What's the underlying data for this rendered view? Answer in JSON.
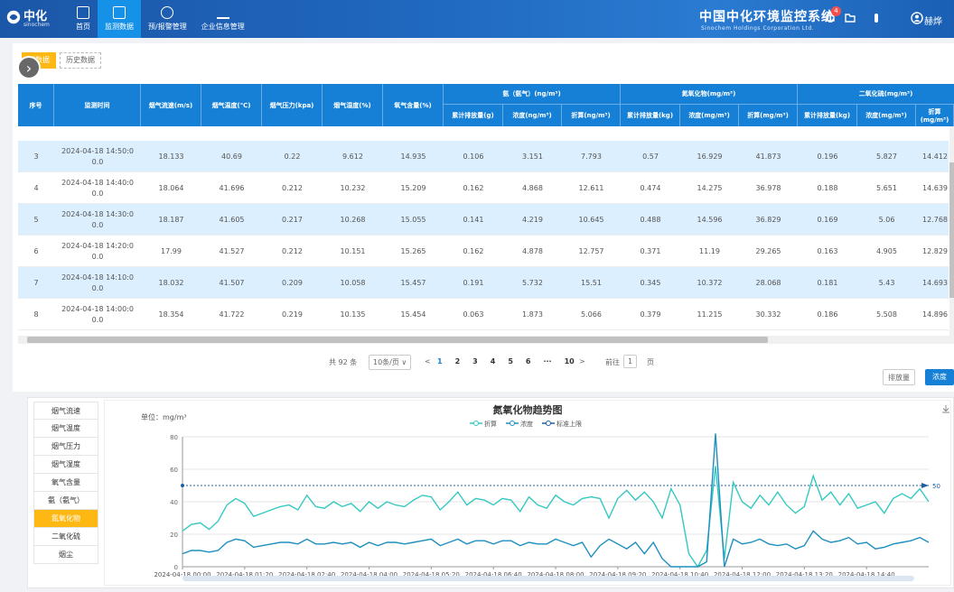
{
  "header": {
    "logo_text": "中化",
    "logo_sub": "sinochem",
    "nav": [
      {
        "label": "首页",
        "icon": "home-icon"
      },
      {
        "label": "监测数据",
        "icon": "monitor-icon"
      },
      {
        "label": "预/报警管理",
        "icon": "alarm-icon"
      },
      {
        "label": "企业信息管理",
        "icon": "enterprise-icon"
      }
    ],
    "active_nav": 1,
    "title": "中国中化环境监控系统",
    "subtitle": "Sinochem Holdings Corporation Ltd.",
    "bell_count": "4",
    "user": "赫烨"
  },
  "tabs": [
    "时数据",
    "历史数据"
  ],
  "table": {
    "headers": {
      "index": "序号",
      "time": "监测时间",
      "flow": "烟气流速(m/s)",
      "temp": "烟气温度(℃)",
      "pressure": "烟气压力(kpa)",
      "humidity": "烟气湿度(%)",
      "oxygen": "氧气含量(%)",
      "ammonia": "氨（氨气）(ng/m³)",
      "nox": "氮氧化物(mg/m³)",
      "so2": "二氧化硫(mg/m³)",
      "amm_sub": [
        "累计排放量(g)",
        "浓度(ng/m³)",
        "折算(ng/m³)"
      ],
      "nox_sub": [
        "累计排放量(kg)",
        "浓度(mg/m³)",
        "折算(mg/m³)"
      ],
      "so2_sub": [
        "累计排放量(kg)",
        "浓度(mg/m³)",
        "折算(mg/m³)"
      ]
    },
    "rows": [
      [
        "3",
        "2024-04-18 14:50:0\n0.0",
        "18.133",
        "40.69",
        "0.22",
        "9.612",
        "14.935",
        "0.106",
        "3.151",
        "7.793",
        "0.57",
        "16.929",
        "41.873",
        "0.196",
        "5.827",
        "14.412"
      ],
      [
        "4",
        "2024-04-18 14:40:0\n0.0",
        "18.064",
        "41.696",
        "0.212",
        "10.232",
        "15.209",
        "0.162",
        "4.868",
        "12.611",
        "0.474",
        "14.275",
        "36.978",
        "0.188",
        "5.651",
        "14.639"
      ],
      [
        "5",
        "2024-04-18 14:30:0\n0.0",
        "18.187",
        "41.605",
        "0.217",
        "10.268",
        "15.055",
        "0.141",
        "4.219",
        "10.645",
        "0.488",
        "14.596",
        "36.829",
        "0.169",
        "5.06",
        "12.768"
      ],
      [
        "6",
        "2024-04-18 14:20:0\n0.0",
        "17.99",
        "41.527",
        "0.212",
        "10.151",
        "15.265",
        "0.162",
        "4.878",
        "12.757",
        "0.371",
        "11.19",
        "29.265",
        "0.163",
        "4.905",
        "12.829"
      ],
      [
        "7",
        "2024-04-18 14:10:0\n0.0",
        "18.032",
        "41.507",
        "0.209",
        "10.058",
        "15.457",
        "0.191",
        "5.732",
        "15.51",
        "0.345",
        "10.372",
        "28.068",
        "0.181",
        "5.43",
        "14.693"
      ],
      [
        "8",
        "2024-04-18 14:00:0\n0.0",
        "18.354",
        "41.722",
        "0.219",
        "10.135",
        "15.454",
        "0.063",
        "1.873",
        "5.066",
        "0.379",
        "11.215",
        "30.332",
        "0.186",
        "5.508",
        "14.896"
      ]
    ]
  },
  "pager": {
    "total": "共 92 条",
    "size": "10条/页",
    "pages": [
      "1",
      "2",
      "3",
      "4",
      "5",
      "6",
      "···",
      "10"
    ],
    "current": "1",
    "goto": "前往",
    "goto_value": "1",
    "page_unit": "页",
    "prev": "<",
    "next": ">"
  },
  "buttons": {
    "emission": "排放量",
    "concentration": "浓度"
  },
  "side_items": [
    "烟气流速",
    "烟气温度",
    "烟气压力",
    "烟气湿度",
    "氧气含量",
    "氨（氨气）",
    "氮氧化物",
    "二氧化硫",
    "烟尘"
  ],
  "side_active": 6,
  "colors": {
    "primary": "#1680d6",
    "accent": "#fdb813",
    "series1": "#34c9c0",
    "series2": "#1e8fbf",
    "limit": "#1f5fa0"
  },
  "chart_data": {
    "type": "line",
    "title": "氮氧化物趋势图",
    "unit": "单位：mg/m³",
    "legend": [
      "折算",
      "浓度",
      "标准上限"
    ],
    "ylim": [
      0,
      80
    ],
    "yticks": [
      0,
      20,
      40,
      60,
      80
    ],
    "xticks": [
      "2024-04-18 00:00",
      "2024-04-18 01:20",
      "2024-04-18 02:40",
      "2024-04-18 04:00",
      "2024-04-18 05:20",
      "2024-04-18 06:40",
      "2024-04-18 08:00",
      "2024-04-18 09:20",
      "2024-04-18 10:40",
      "2024-04-18 12:00",
      "2024-04-18 13:20",
      "2024-04-18 14:40"
    ],
    "limit": 50,
    "limit_label": "50",
    "series": [
      {
        "name": "折算",
        "values": [
          22,
          26,
          27,
          23,
          28,
          38,
          42,
          39,
          31,
          33,
          35,
          37,
          38,
          35,
          44,
          37,
          36,
          40,
          37,
          39,
          34,
          40,
          36,
          40,
          38,
          37,
          41,
          44,
          43,
          35,
          40,
          46,
          38,
          42,
          41,
          38,
          42,
          41,
          34,
          43,
          38,
          36,
          44,
          40,
          38,
          42,
          43,
          42,
          30,
          42,
          47,
          41,
          46,
          40,
          30,
          48,
          38,
          8,
          0,
          10,
          62,
          5,
          52,
          40,
          36,
          44,
          38,
          46,
          38,
          33,
          37,
          56,
          41,
          46,
          38,
          45,
          36,
          38,
          40,
          33,
          42,
          45,
          42,
          48,
          40
        ]
      },
      {
        "name": "浓度",
        "values": [
          8,
          10,
          10,
          9,
          10,
          15,
          17,
          16,
          12,
          13,
          14,
          15,
          15,
          14,
          17,
          14,
          14,
          15,
          14,
          15,
          12,
          15,
          13,
          15,
          15,
          14,
          15,
          16,
          17,
          13,
          15,
          17,
          14,
          16,
          16,
          14,
          16,
          16,
          13,
          15,
          14,
          14,
          17,
          15,
          13,
          15,
          6,
          13,
          17,
          14,
          11,
          15,
          8,
          15,
          5,
          0,
          0,
          0,
          0,
          3,
          82,
          0,
          17,
          14,
          15,
          17,
          14,
          13,
          14,
          11,
          13,
          22,
          17,
          15,
          16,
          18,
          14,
          15,
          11,
          12,
          14,
          15,
          16,
          18,
          15
        ]
      }
    ]
  }
}
